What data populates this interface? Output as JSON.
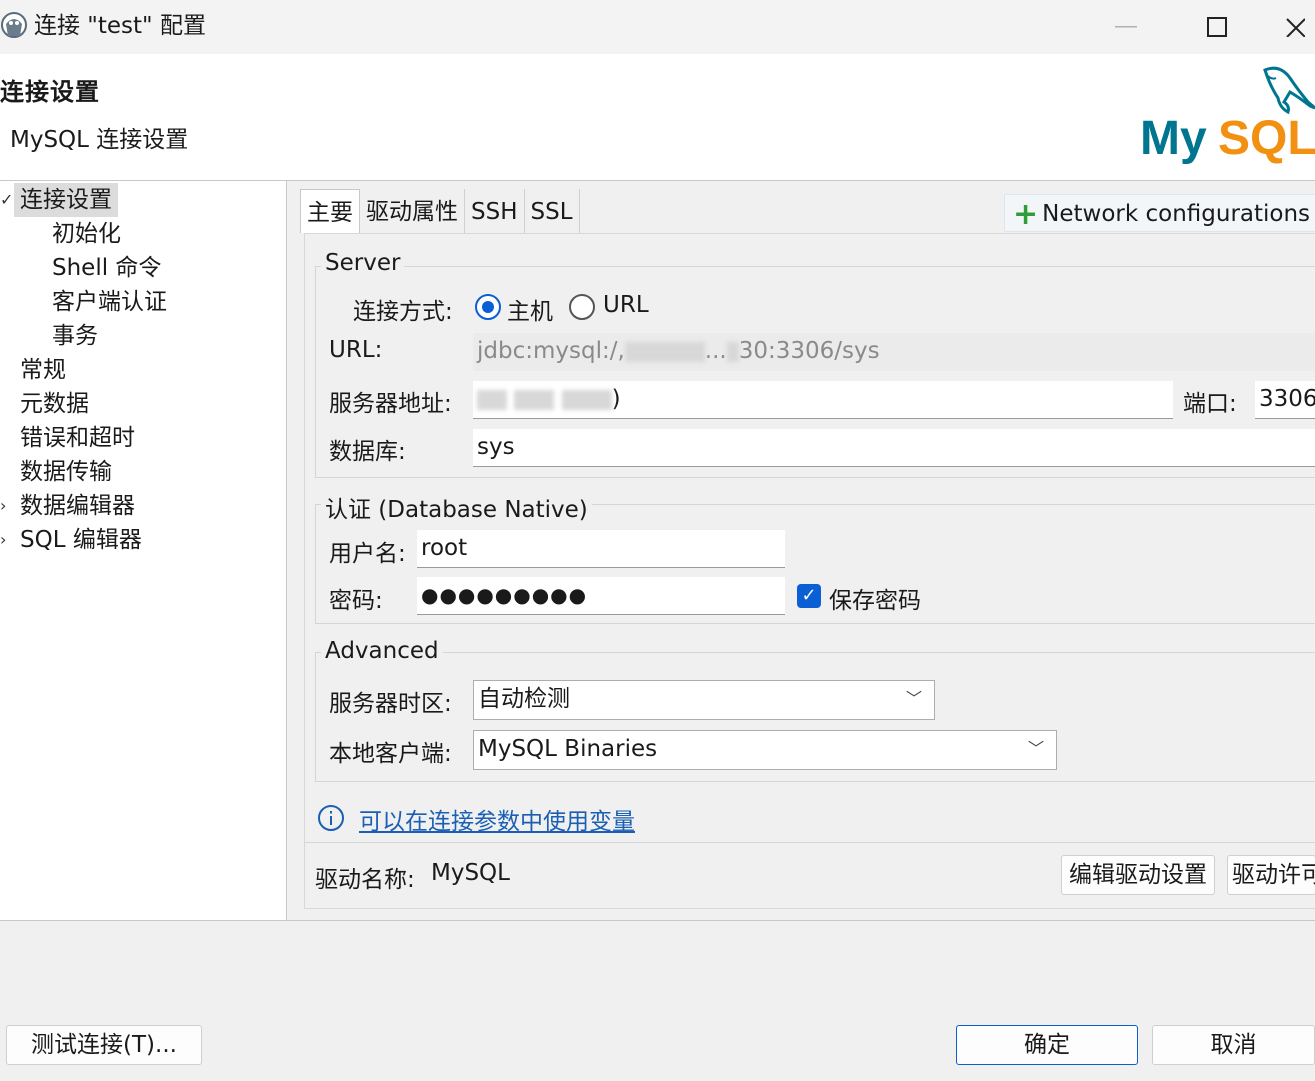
{
  "window": {
    "title": "连接 \"test\" 配置",
    "icon": "dbeaver-icon"
  },
  "header": {
    "title": "连接设置",
    "subtitle": "MySQL 连接设置",
    "logo_text": "MySQL"
  },
  "tree": {
    "items": [
      {
        "label": "连接设置",
        "arrow": "✓",
        "selected": true
      },
      {
        "label": "初始化"
      },
      {
        "label": "Shell 命令"
      },
      {
        "label": "客户端认证"
      },
      {
        "label": "事务"
      },
      {
        "label": "常规"
      },
      {
        "label": "元数据"
      },
      {
        "label": "错误和超时"
      },
      {
        "label": "数据传输"
      },
      {
        "label": "数据编辑器",
        "arrow": "›"
      },
      {
        "label": "SQL 编辑器",
        "arrow": "›"
      }
    ]
  },
  "tabs": [
    {
      "label": "主要",
      "active": true
    },
    {
      "label": "驱动属性"
    },
    {
      "label": "SSH"
    },
    {
      "label": "SSL"
    }
  ],
  "network_config_label": "Network configurations",
  "server": {
    "group_label": "Server",
    "connect_by_label": "连接方式:",
    "option_host": "主机",
    "option_url": "URL",
    "url_label": "URL:",
    "url_prefix": "jdbc:mysql:/,",
    "url_mid": "...",
    "url_suffix": "30:3306/sys",
    "host_label": "服务器地址:",
    "host_value_suffix": ")",
    "port_label": "端口:",
    "port_value": "3306",
    "db_label": "数据库:",
    "db_value": "sys"
  },
  "auth": {
    "group_label": "认证 (Database Native)",
    "user_label": "用户名:",
    "user_value": "root",
    "password_label": "密码:",
    "password_value": "●●●●●●●●●",
    "save_password_label": "保存密码"
  },
  "advanced": {
    "group_label": "Advanced",
    "timezone_label": "服务器时区:",
    "timezone_value": "自动检测",
    "client_label": "本地客户端:",
    "client_value": "MySQL Binaries"
  },
  "variables_link": "可以在连接参数中使用变量",
  "driver": {
    "name_label": "驱动名称:",
    "name_value": "MySQL",
    "edit_button": "编辑驱动设置",
    "license_button": "驱动许可"
  },
  "footer": {
    "test_button": "测试连接(T)...",
    "ok_button": "确定",
    "cancel_button": "取消"
  },
  "colors": {
    "accent": "#0a5fd4",
    "link": "#1a5fb4",
    "mysql_blue": "#00758f",
    "mysql_orange": "#f29111",
    "plus_green": "#2e9d3a"
  }
}
